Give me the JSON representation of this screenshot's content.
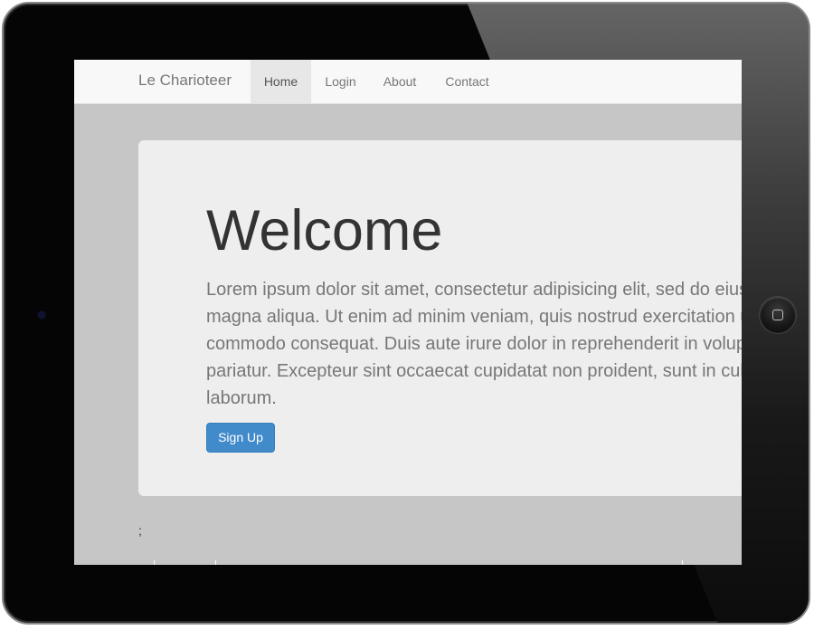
{
  "navbar": {
    "brand": "Le Charioteer",
    "items": [
      {
        "label": "Home",
        "active": true
      },
      {
        "label": "Login",
        "active": false
      },
      {
        "label": "About",
        "active": false
      },
      {
        "label": "Contact",
        "active": false
      }
    ]
  },
  "jumbotron": {
    "title": "Welcome",
    "text_lines": [
      "Lorem ipsum dolor sit amet, consectetur adipisicing elit, sed do eiusmod tempor incididunt ut labore et dolore",
      "magna aliqua. Ut enim ad minim veniam, quis nostrud exercitation ullamco laboris nisi ut aliquip ex ea",
      "commodo consequat. Duis aute irure dolor in reprehenderit in voluptate velit esse cillum dolore eu fugiat nulla",
      "pariatur. Excepteur sint occaecat cupidatat non proident, sunt in culpa qui officia deserunt mollit anim id est",
      "laborum."
    ],
    "button_label": "Sign Up"
  },
  "stray_text": ";",
  "colors": {
    "primary_button": "#428bca",
    "page_background": "#c6c6c6",
    "jumbotron_background": "#eeeeee",
    "navbar_background": "#f8f8f8",
    "device_frame": "#050505"
  },
  "icons": {
    "home_button": "home-button-icon",
    "camera": "camera-icon"
  }
}
